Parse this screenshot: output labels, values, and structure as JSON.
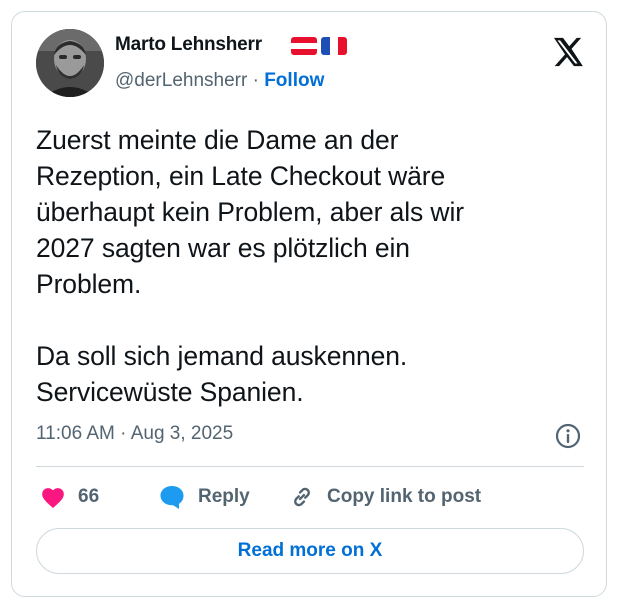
{
  "author": {
    "name": "Marto Lehnsherr",
    "handle": "@derLehnsherr",
    "separator": "·",
    "follow_label": "Follow",
    "flags": [
      "austria-flag",
      "france-flag"
    ]
  },
  "tweet": {
    "lines": [
      "Zuerst meinte die Dame an der",
      "Rezeption, ein Late Checkout wäre",
      "überhaupt kein Problem, aber als wir",
      "2027 sagten war es plötzlich ein",
      "Problem.",
      "Da soll sich jemand auskennen.",
      "Servicewüste Spanien."
    ],
    "timestamp": "11:06 AM · Aug 3, 2025"
  },
  "actions": {
    "likes_count": "66",
    "reply_label": "Reply",
    "copy_label": "Copy link to post"
  },
  "read_more_label": "Read more on X",
  "colors": {
    "text": "#0f1419",
    "secondary": "#536471",
    "link": "#006fd6",
    "like": "#f91880",
    "reply": "#1d9bf0",
    "border": "#cfd9de"
  },
  "icons": [
    "x-logo-icon",
    "info-icon",
    "heart-icon",
    "reply-bubble-icon",
    "link-icon"
  ]
}
